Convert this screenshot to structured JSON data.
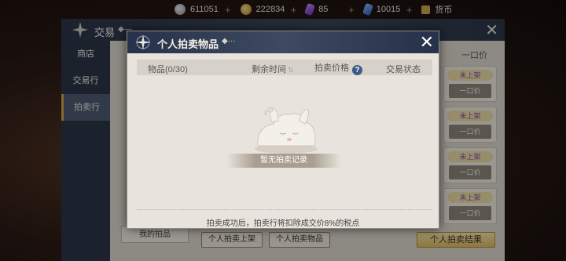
{
  "currencies": [
    {
      "icon": "silver-coin-icon",
      "value": "611051",
      "plus": "+"
    },
    {
      "icon": "gold-coin-icon",
      "value": "222834",
      "plus": "+"
    },
    {
      "icon": "purple-crystal-icon",
      "value": "85",
      "plus": "+"
    },
    {
      "icon": "blue-crystal-icon",
      "value": "10015",
      "plus": "+"
    },
    {
      "icon": "currency-box-icon",
      "value": "货币",
      "plus": ""
    }
  ],
  "trade_window": {
    "title": "交易",
    "title_deco": "◆—",
    "close": "✕",
    "nav": [
      "商店",
      "交易行",
      "拍卖行"
    ],
    "active_nav": "拍卖行",
    "right_header": "一口价",
    "rows": [
      {
        "status": "未上架",
        "buy": "一口价"
      },
      {
        "status": "未上架",
        "buy": "一口价"
      },
      {
        "status": "未上架",
        "buy": "一口价"
      },
      {
        "status": "未上架",
        "buy": "一口价"
      }
    ],
    "my_auction": "我的拍品",
    "buttons": {
      "list": "个人拍卖上架",
      "items": "个人拍卖物品",
      "results": "个人拍卖结果"
    }
  },
  "modal": {
    "title": "个人拍卖物品",
    "title_deco": "◆···",
    "close": "✕",
    "columns": {
      "item": "物品(0/30)",
      "time_left": "剩余时间",
      "price": "拍卖价格",
      "status": "交易状态"
    },
    "help": "?",
    "sort_glyph": "⇅",
    "empty_text": "暂无拍卖记录",
    "footnote": "拍卖成功后，拍卖行将扣除成交价8%的税点"
  },
  "colors": {
    "header_navy": "#26314a",
    "panel_bg": "#e8e4dd",
    "accent_gold": "#c9a34a",
    "help_blue": "#3d5a86",
    "unlisted_purple": "#7a4ea8"
  }
}
